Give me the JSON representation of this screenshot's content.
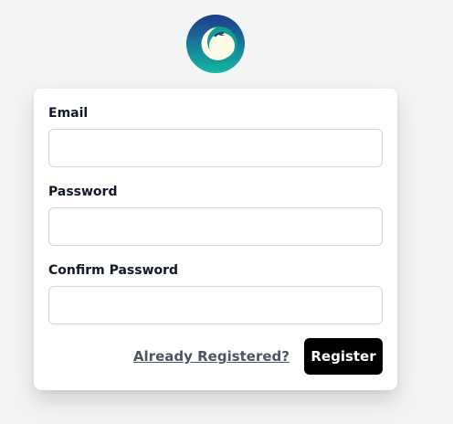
{
  "logo": {
    "icon": "crescent-moon-plane-logo",
    "colors": {
      "outer": "#1e3a8a",
      "inner": "#14b8a6",
      "moon": "#fefce8"
    }
  },
  "form": {
    "email_label": "Email",
    "email_value": "",
    "password_label": "Password",
    "password_value": "",
    "confirm_password_label": "Confirm Password",
    "confirm_password_value": "",
    "already_registered_link": "Already Registered?",
    "register_button": "Register"
  }
}
